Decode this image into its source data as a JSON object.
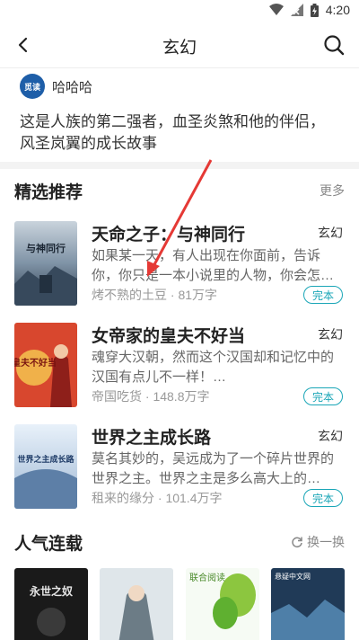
{
  "status_bar": {
    "time": "4:20"
  },
  "header": {
    "title": "玄幻"
  },
  "author": {
    "name": "哈哈哈",
    "avatar_text": "觅读"
  },
  "description": "这是人族的第二强者，血圣炎煞和他的伴侣，风圣岚翼的成长故事",
  "featured": {
    "title": "精选推荐",
    "more": "更多",
    "books": [
      {
        "title": "天命之子：与神同行",
        "genre": "玄幻",
        "intro": "如果某一天，有人出现在你面前，告诉你，你只是一本小说里的人物，你会怎…",
        "author": "烤不熟的土豆",
        "words": "81万字",
        "status": "完本",
        "cover_text": "与神同行"
      },
      {
        "title": "女帝家的皇夫不好当",
        "genre": "玄幻",
        "intro": "魂穿大汉朝，然而这个汉国却和记忆中的汉国有点儿不一样！…",
        "author": "帝国吃货",
        "words": "148.8万字",
        "status": "完本",
        "cover_text": "皇夫不好当"
      },
      {
        "title": "世界之主成长路",
        "genre": "玄幻",
        "intro": "莫名其妙的，吴远成为了一个碎片世界的世界之主。世界之主是多么高大上的…",
        "author": "租来的缘分",
        "words": "101.4万字",
        "status": "完本",
        "cover_text": "世界之主成长路"
      }
    ]
  },
  "popular": {
    "title": "人气连载",
    "refresh": "换一换",
    "covers": [
      {
        "text": "永世之奴"
      },
      {
        "text": ""
      },
      {
        "text": "联合阅读"
      },
      {
        "text": "悬疑中文网"
      }
    ]
  },
  "colors": {
    "accent": "#1aa6b7",
    "annotation_arrow": "#e53935"
  }
}
